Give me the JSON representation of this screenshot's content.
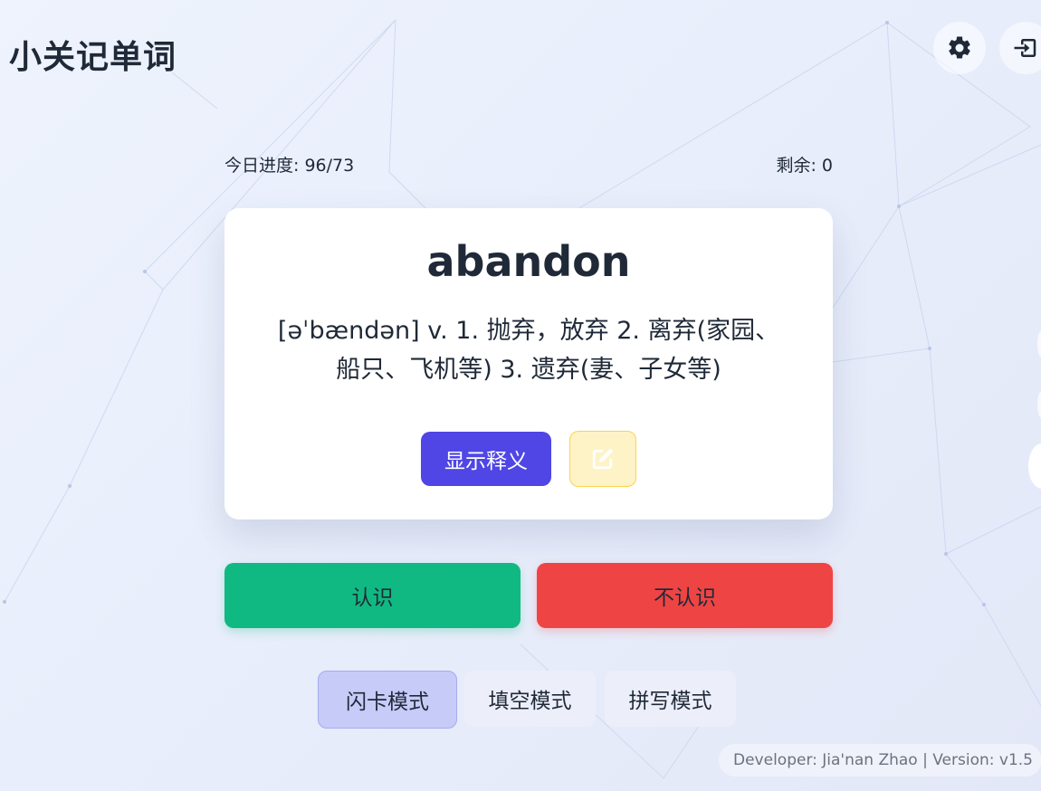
{
  "app": {
    "title": "小关记单词"
  },
  "header": {
    "settings_icon": "gear-icon",
    "logout_icon": "logout-icon"
  },
  "progress": {
    "today_label": "今日进度: 96/73",
    "remaining_label": "剩余: 0"
  },
  "card": {
    "word": "abandon",
    "definition_line1": "[əˈbændən] v. 1. 抛弃，放弃 2. 离弃(家园、",
    "definition_line2": "船只、飞机等) 3. 遗弃(妻、子女等)",
    "show_meaning_label": "显示释义",
    "edit_icon": "edit-icon"
  },
  "actions": {
    "know_label": "认识",
    "unknow_label": "不认识"
  },
  "modes": [
    {
      "label": "闪卡模式",
      "active": true
    },
    {
      "label": "填空模式",
      "active": false
    },
    {
      "label": "拼写模式",
      "active": false
    }
  ],
  "footer": {
    "text": "Developer: Jia'nan Zhao | Version: v1.5"
  },
  "colors": {
    "primary": "#4f46e5",
    "know": "#10b981",
    "unknow": "#ef4444",
    "edit_bg": "#fef3c7",
    "active_mode": "#c7cbf8"
  }
}
